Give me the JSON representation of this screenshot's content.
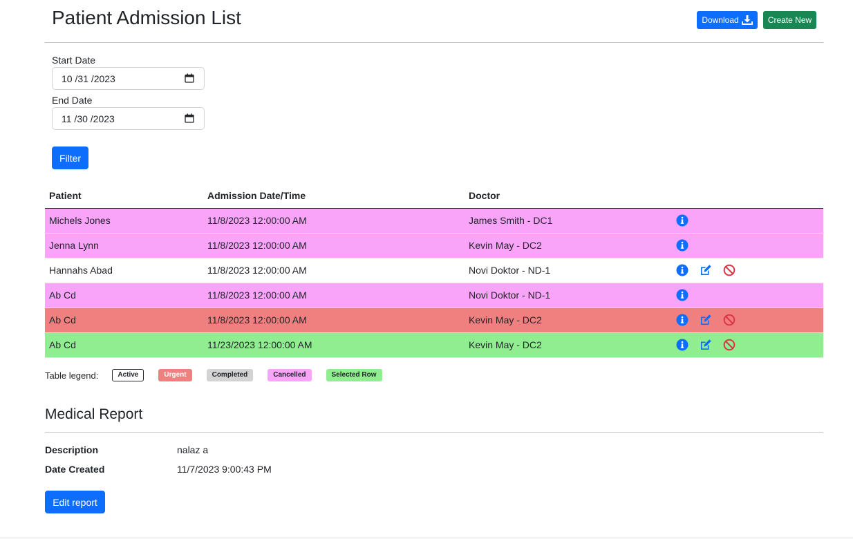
{
  "header": {
    "title": "Patient Admission List",
    "download_label": "Download",
    "create_label": "Create New"
  },
  "filter": {
    "start_label": "Start Date",
    "start_value": "10 /31 /2023",
    "end_label": "End Date",
    "end_value": "11 /30 /2023",
    "button_label": "Filter"
  },
  "table": {
    "headers": [
      "Patient",
      "Admission Date/Time",
      "Doctor",
      ""
    ],
    "rows": [
      {
        "patient": "Michels Jones",
        "admission": "11/8/2023 12:00:00 AM",
        "doctor": "James Smith - DC1",
        "status": "cancelled",
        "actions": [
          "info"
        ]
      },
      {
        "patient": "Jenna Lynn",
        "admission": "11/8/2023 12:00:00 AM",
        "doctor": "Kevin May - DC2",
        "status": "cancelled",
        "actions": [
          "info"
        ]
      },
      {
        "patient": "Hannahs Abad",
        "admission": "11/8/2023 12:00:00 AM",
        "doctor": "Novi Doktor - ND-1",
        "status": "active",
        "actions": [
          "info",
          "edit",
          "cancel"
        ]
      },
      {
        "patient": "Ab Cd",
        "admission": "11/8/2023 12:00:00 AM",
        "doctor": "Novi Doktor - ND-1",
        "status": "cancelled",
        "actions": [
          "info"
        ]
      },
      {
        "patient": "Ab Cd",
        "admission": "11/8/2023 12:00:00 AM",
        "doctor": "Kevin May - DC2",
        "status": "urgent",
        "actions": [
          "info",
          "edit",
          "cancel"
        ]
      },
      {
        "patient": "Ab Cd",
        "admission": "11/23/2023 12:00:00 AM",
        "doctor": "Kevin May - DC2",
        "status": "selected",
        "actions": [
          "info",
          "edit",
          "cancel"
        ]
      }
    ]
  },
  "legend": {
    "label": "Table legend:",
    "items": [
      "Active",
      "Urgent",
      "Completed",
      "Cancelled",
      "Selected Row"
    ]
  },
  "report": {
    "title": "Medical Report",
    "description_label": "Description",
    "description_value": "nalaz a",
    "date_label": "Date Created",
    "date_value": "11/7/2023 9:00:43 PM",
    "edit_label": "Edit report"
  },
  "colors": {
    "primary": "#0d6efd",
    "success": "#198754",
    "cancelled": "#f9a3f9",
    "urgent": "#f08080",
    "completed": "#d3d3d3",
    "selected": "#90ee90",
    "danger": "#dc3545"
  }
}
